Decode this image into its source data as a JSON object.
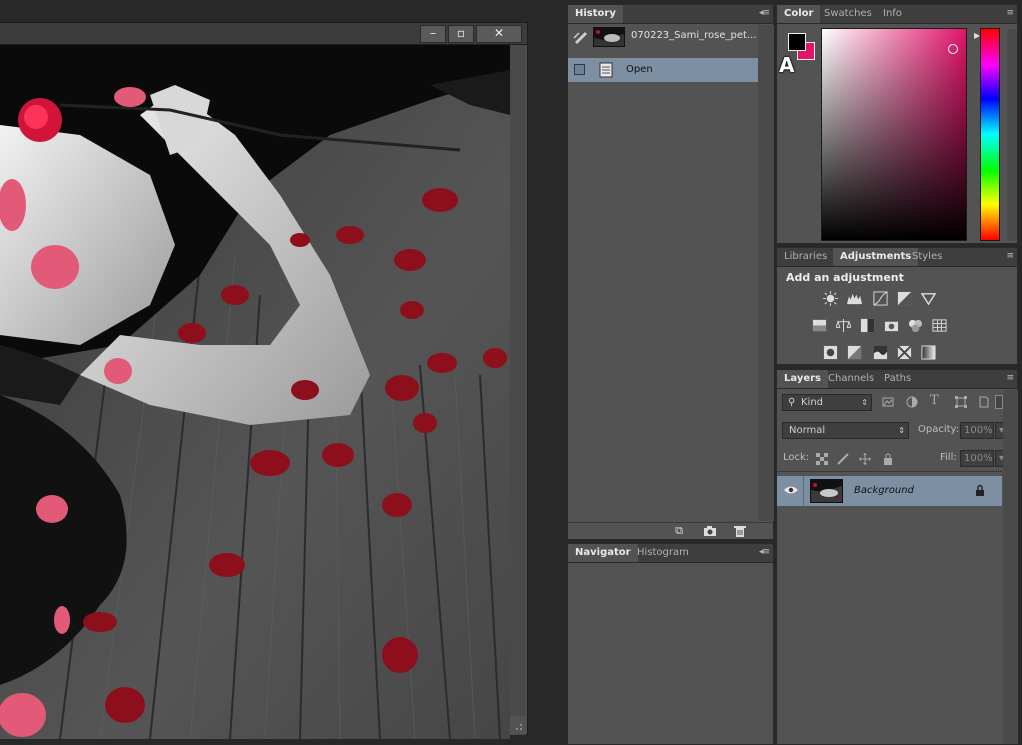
{
  "document": {
    "controls": {
      "minimize": "–",
      "restore": "▫",
      "close": "✕"
    }
  },
  "history": {
    "tabs": [
      "History"
    ],
    "snapshot_label": "070223_Sami_rose_pet...",
    "states": [
      {
        "label": "Open",
        "icon": "document-icon"
      }
    ],
    "footer_icons": [
      "new-document-from-state-icon",
      "camera-icon",
      "trash-icon"
    ]
  },
  "navigator": {
    "tabs": [
      "Navigator",
      "Histogram"
    ]
  },
  "color": {
    "tabs": [
      "Color",
      "Swatches",
      "Info"
    ],
    "foreground": "#000000",
    "background": "#e3146a",
    "gamut_warning": "A"
  },
  "adjustments": {
    "tabs": [
      "Libraries",
      "Adjustments",
      "Styles"
    ],
    "heading": "Add an adjustment",
    "rows": [
      [
        "brightness-contrast-icon",
        "levels-icon",
        "curves-icon",
        "exposure-icon",
        "vibrance-icon"
      ],
      [
        "hue-saturation-icon",
        "color-balance-icon",
        "black-white-icon",
        "photo-filter-icon",
        "channel-mixer-icon",
        "color-lookup-icon"
      ],
      [
        "invert-icon",
        "posterize-icon",
        "threshold-icon",
        "selective-color-icon",
        "gradient-map-icon"
      ]
    ]
  },
  "layers": {
    "tabs": [
      "Layers",
      "Channels",
      "Paths"
    ],
    "filter_kind": "Kind",
    "blend_mode": "Normal",
    "opacity_label": "Opacity:",
    "opacity_value": "100%",
    "lock_label": "Lock:",
    "fill_label": "Fill:",
    "fill_value": "100%",
    "items": [
      {
        "name": "Background",
        "visible": true,
        "locked": true
      }
    ]
  }
}
